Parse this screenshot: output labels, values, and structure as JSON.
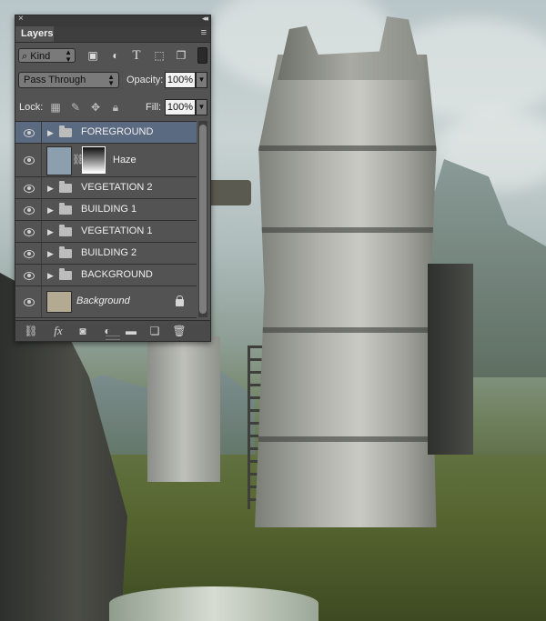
{
  "panel": {
    "tab_label": "Layers",
    "close_glyph": "×",
    "collapse_glyph": "◂◂",
    "menu_glyph": "≡"
  },
  "filter": {
    "kind_label": "Kind",
    "icons": [
      "image-filter-icon",
      "adjustment-filter-icon",
      "type-filter-icon",
      "shape-filter-icon",
      "smart-object-filter-icon"
    ]
  },
  "blend": {
    "mode": "Pass Through",
    "opacity_label": "Opacity:",
    "opacity_value": "100%"
  },
  "lock": {
    "label": "Lock:",
    "fill_label": "Fill:",
    "fill_value": "100%"
  },
  "layers": [
    {
      "name": "FOREGROUND",
      "type": "group",
      "visible": true,
      "selected": true
    },
    {
      "name": "Haze",
      "type": "adjustment",
      "visible": true,
      "selected": false
    },
    {
      "name": "VEGETATION 2",
      "type": "group",
      "visible": true,
      "selected": false
    },
    {
      "name": "BUILDING 1",
      "type": "group",
      "visible": true,
      "selected": false
    },
    {
      "name": "VEGETATION 1",
      "type": "group",
      "visible": true,
      "selected": false
    },
    {
      "name": "BUILDING 2",
      "type": "group",
      "visible": true,
      "selected": false
    },
    {
      "name": "BACKGROUND",
      "type": "group",
      "visible": true,
      "selected": false
    },
    {
      "name": "Background",
      "type": "background",
      "visible": true,
      "locked": true,
      "selected": false
    }
  ],
  "footer": {
    "icons": [
      "link-layers-icon",
      "fx-icon",
      "add-mask-icon",
      "new-adjustment-icon",
      "new-group-icon",
      "new-layer-icon",
      "trash-icon"
    ],
    "fx_label": "fx"
  },
  "colors": {
    "panel_bg": "#535353",
    "selected_row": "#5a6a81",
    "haze_thumb": "#8c9fae",
    "background_thumb": "#b4aa91"
  }
}
